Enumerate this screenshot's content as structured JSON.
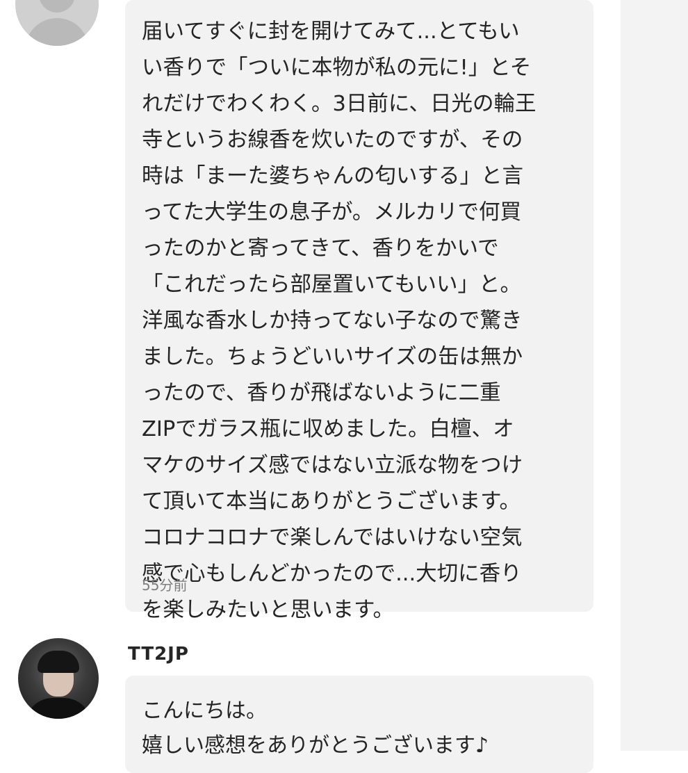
{
  "comment_1": {
    "lines": [
      "届いてすぐに封を開けてみて...とてもい",
      "い香りで「ついに本物が私の元に!」とそ",
      "れだけでわくわく。3日前に、日光の輪王",
      "寺というお線香を炊いたのですが、その",
      "時は「まーた婆ちゃんの匂いする」と言",
      "ってた大学生の息子が。メルカリで何買",
      "ったのかと寄ってきて、香りをかいで",
      "「これだったら部屋置いてもいい」と。",
      "洋風な香水しか持ってない子なので驚き",
      "ました。ちょうどいいサイズの缶は無か",
      "ったので、香りが飛ばないように二重",
      "ZIPでガラス瓶に収めました。白檀、オ",
      "マケのサイズ感ではない立派な物をつけ",
      "て頂いて本当にありがとうございます。",
      "コロナコロナで楽しんではいけない空気",
      "感で心もしんどかったので...大切に香り",
      "を楽しみたいと思います。"
    ],
    "timestamp": "55分前"
  },
  "comment_2": {
    "username": "TT2JP",
    "lines": [
      "こんにちは。",
      "嬉しい感想をありがとうございます♪"
    ]
  }
}
